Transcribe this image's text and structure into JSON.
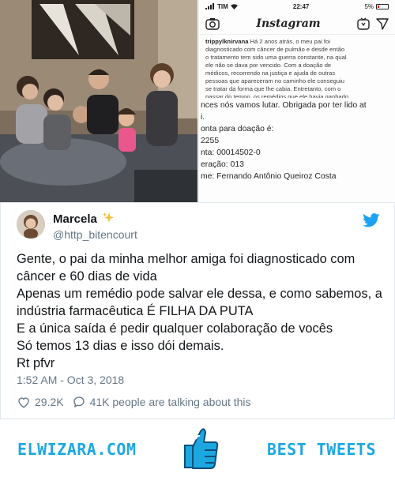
{
  "instagram": {
    "carrier": "TIM",
    "time": "22:47",
    "battery": "5%",
    "logo": "Instagram",
    "caption_user": "trippylknirvana",
    "caption_lines": [
      "Há 2 anos atrás, o meu pai foi",
      "diagnosticado com câncer de pulmão e desde então",
      "o tratamento tem sido uma guerra constante, na qual",
      "ele não se dava por vencido. Com a doação de",
      "médicos, recorrendo na justiça e ajuda de outras",
      "pessoas que apareceram no caminho ele conseguiu",
      "se tratar da forma que lhe cabia. Entretanto, com o",
      "passar do tempo, os remédios que ele havia ganhado"
    ],
    "big_lines": [
      "nces nós vamos lutar. Obrigada por ter lido at",
      "i.",
      "onta para doação é:",
      "2255",
      "nta: 00014502-0",
      "eração: 013",
      "me: Fernando Antônio Queiroz Costa"
    ]
  },
  "tweet": {
    "display_name": "Marcela",
    "handle": "@http_bitencourt",
    "text_lines": [
      "Gente, o pai da minha melhor amiga foi diagnosticado com",
      "câncer e 60 dias de vida",
      "Apenas um remédio pode salvar ele dessa, e como sabemos, a",
      "indústria farmacêutica É FILHA DA PUTA",
      "E a única saída é pedir qualquer colaboração de vocês",
      "Só temos 13 dias e isso dói demais.",
      "Rt pfvr"
    ],
    "timestamp": "1:52 AM - Oct 3, 2018",
    "likes": "29.2K",
    "talking": "41K people are talking about this"
  },
  "footer": {
    "left_text": "ELWIZARA.COM",
    "right_text": "BEST TWEETS"
  },
  "colors": {
    "brand_blue": "#1da7e0",
    "twitter_blue": "#1da1f2",
    "muted": "#657786"
  },
  "icons": {
    "camera": "camera-icon",
    "igtv": "igtv-icon",
    "direct": "direct-message-icon",
    "sparkle": "sparkles-icon",
    "bird": "twitter-bird-icon",
    "heart": "heart-icon",
    "reply": "comment-bubble-icon",
    "thumb": "thumbs-up-icon"
  }
}
